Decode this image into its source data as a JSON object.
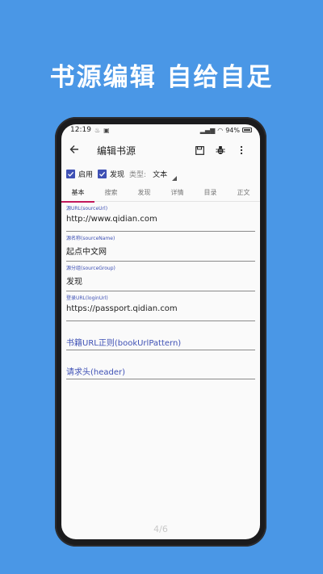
{
  "headline": "书源编辑  自给自足",
  "status": {
    "time": "12:19",
    "battery": "94%"
  },
  "toolbar": {
    "back_icon": "arrow-left-icon",
    "title": "编辑书源",
    "save_icon": "save-icon",
    "debug_icon": "bug-icon",
    "menu_icon": "more-vert-icon"
  },
  "options": {
    "enable_label": "启用",
    "discover_label": "发现",
    "type_label": "类型:",
    "type_value": "文本"
  },
  "tabs": [
    "基本",
    "搜索",
    "发现",
    "详情",
    "目录",
    "正文"
  ],
  "fields": [
    {
      "label": "源URL(sourceUrl)",
      "value": "http://www.qidian.com"
    },
    {
      "label": "源名称(sourceName)",
      "value": "起点中文网"
    },
    {
      "label": "源分组(sourceGroup)",
      "value": "发现"
    },
    {
      "label": "登录URL(loginUrl)",
      "value": "https://passport.qidian.com"
    }
  ],
  "placeholders": [
    "书籍URL正则(bookUrlPattern)",
    "请求头(header)"
  ],
  "pager": "4/6",
  "colors": {
    "background": "#4a97e6",
    "accent": "#3f51b5",
    "tab_indicator": "#c2185b"
  }
}
